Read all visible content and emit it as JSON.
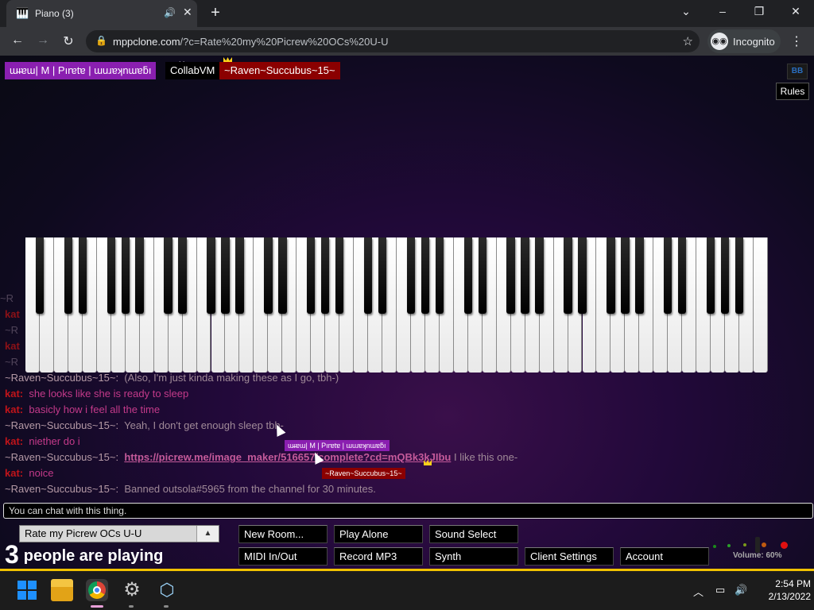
{
  "browser": {
    "tab_title": "Piano (3)",
    "url_domain": "mppclone.com",
    "url_path": "/?c=Rate%20my%20Picrew%20OCs%20U-U",
    "incognito_label": "Incognito"
  },
  "topbar": {
    "user1": "ɯ̴ı̴ɐɯ| M | Pırɐtɐ | ɯuɹɐʞnɯɐƃı",
    "user2": "CollabVM",
    "user2_tag": "Me",
    "user3": "~Raven~Succubus~15~",
    "rules_label": "Rules",
    "settings_icon_label": "BB"
  },
  "chat": {
    "ghost_lines": [
      {
        "text": "~R",
        "type": "name"
      },
      {
        "text": "kat",
        "type": "kat"
      },
      {
        "text": "~R",
        "type": "name"
      },
      {
        "text": "kat",
        "type": "kat"
      },
      {
        "text": "~R",
        "type": "name"
      }
    ],
    "messages": [
      {
        "nick": "~Raven~Succubus~15~:",
        "text": "(Also, I'm just kinda making these as I go, tbh-)"
      },
      {
        "nick": "kat:",
        "text": "she looks like she is ready to sleep"
      },
      {
        "nick": "kat:",
        "text": "basicly how i feel all the time"
      },
      {
        "nick": "~Raven~Succubus~15~:",
        "text": "Yeah, I don't get enough sleep tbh-"
      },
      {
        "nick": "kat:",
        "text": "niether do i"
      },
      {
        "nick": "~Raven~Succubus~15~:",
        "link": "https://picrew.me/image_maker/516657/complete?cd=mQBk3kJIbu",
        "text": "I like this one-"
      },
      {
        "nick": "kat:",
        "text": "noice"
      },
      {
        "nick": "~Raven~Succubus~15~:",
        "text": "Banned outsola#5965 from the channel for 30 minutes."
      }
    ],
    "float_name_1": "ɯ̴ı̴ɐɯ| M | Pırɐtɐ | ɯuɹɐʞnɯɐƃı",
    "float_name_2": "~Raven~Succubus~15~",
    "input_placeholder": "You can chat with this thing."
  },
  "controls": {
    "room_name": "Rate my Picrew OCs U-U",
    "player_count": "3",
    "player_text": "people are playing",
    "buttons": {
      "new_room": "New Room...",
      "play_alone": "Play Alone",
      "sound_select": "Sound Select",
      "midi": "MIDI In/Out",
      "record": "Record MP3",
      "synth": "Synth",
      "client_settings": "Client Settings",
      "account": "Account"
    },
    "volume_label": "Volume: 60%",
    "volume_value": 0.6
  },
  "taskbar": {
    "time": "2:54 PM",
    "date": "2/13/2022"
  },
  "colors": {
    "nick_raven": "#b59aa6",
    "nick_kat": "#c0141a",
    "text_raven": "#a08a98",
    "text_kat": "#c43a8a",
    "user1_bg": "#8a1fb0",
    "user3_bg": "#8b0000"
  }
}
